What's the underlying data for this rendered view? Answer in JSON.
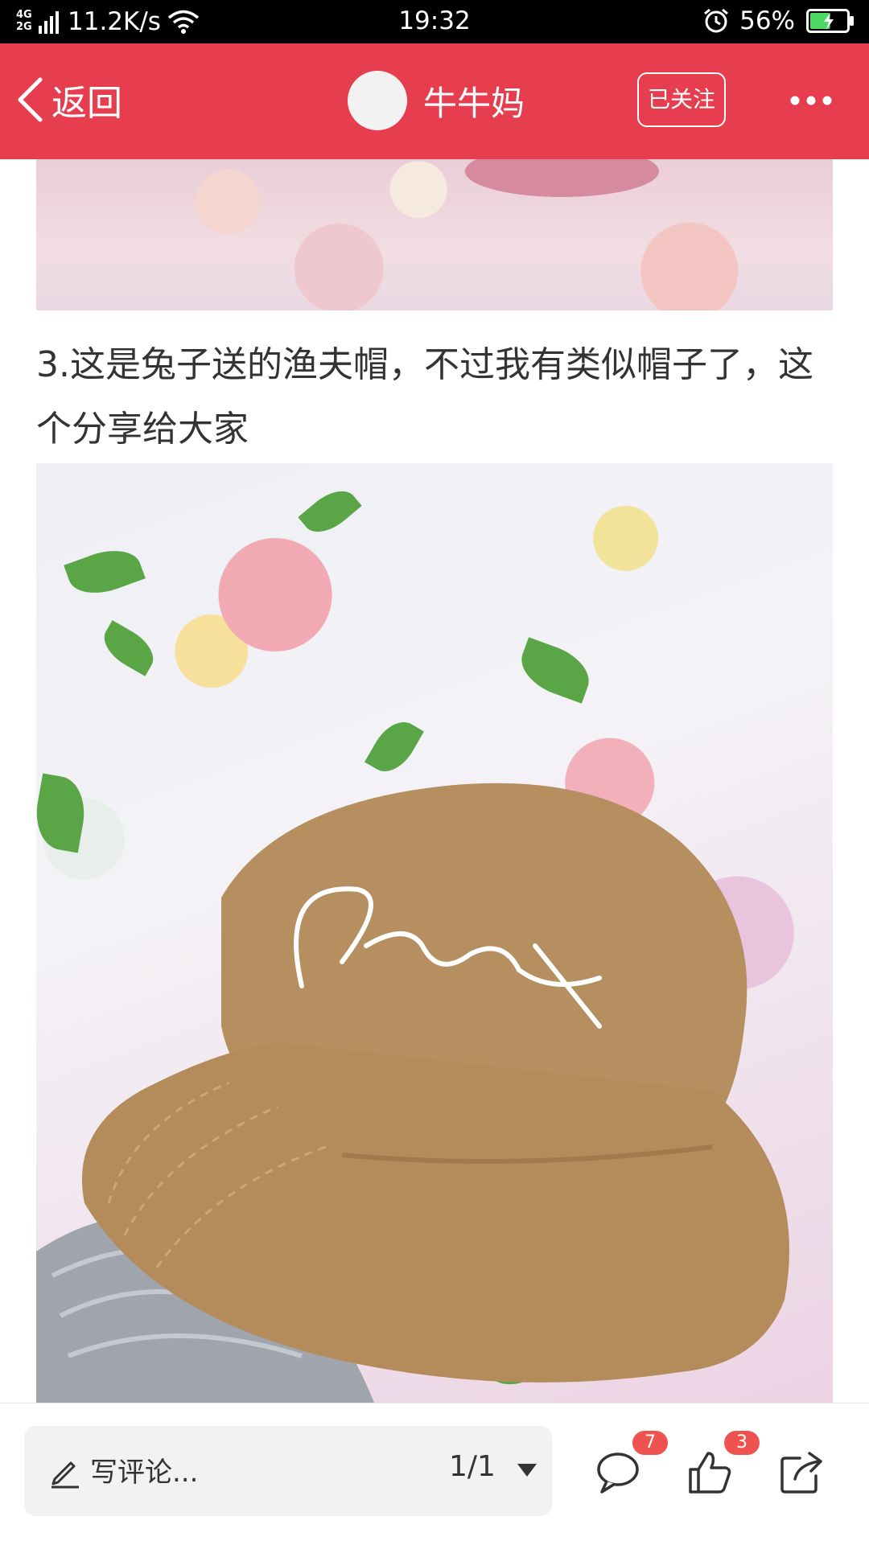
{
  "status_bar": {
    "network_line1": "4G",
    "network_line2": "2G",
    "speed": "11.2K/s",
    "time": "19:32",
    "battery_percent": "56%",
    "battery_level": 0.56
  },
  "header": {
    "back_label": "返回",
    "author_name": "牛牛妈",
    "follow_label": "已关注",
    "colors": {
      "background": "#e63e4e",
      "text": "#ffffff"
    }
  },
  "content": {
    "caption": "3.这是兔子送的渔夫帽，不过我有类似帽子了，这个分享给大家",
    "hat_embroidery": "Originator"
  },
  "bottom_bar": {
    "comment_placeholder": "写评论...",
    "page_indicator": "1/1",
    "comment_count": "7",
    "like_count": "3",
    "badge_color": "#ef5350"
  }
}
